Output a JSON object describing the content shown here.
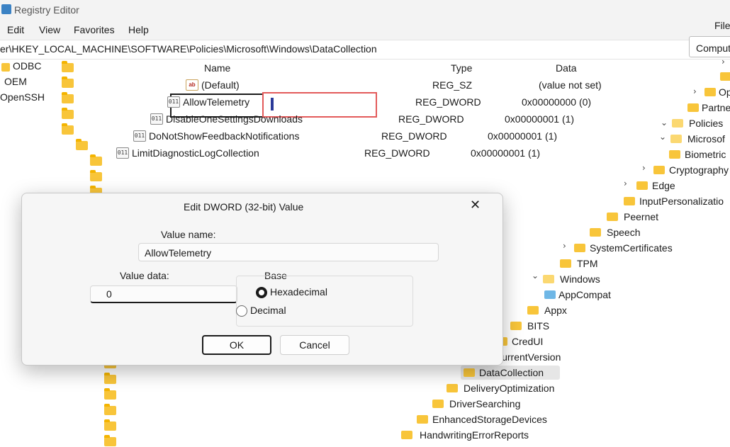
{
  "window": {
    "title": "Registry Editor",
    "right_menu": "File"
  },
  "menu": {
    "items": [
      "Edit",
      "View",
      "Favorites",
      "Help"
    ]
  },
  "address": {
    "path": "er\\HKEY_LOCAL_MACHINE\\SOFTWARE\\Policies\\Microsoft\\Windows\\DataCollection",
    "right_path": "Compute"
  },
  "left_tree": [
    "ODBC",
    "OEM",
    "OpenSSH"
  ],
  "list": {
    "headers": {
      "name": "Name",
      "type": "Type",
      "data": "Data"
    },
    "rows": [
      {
        "name": "(Default)",
        "type": "REG_SZ",
        "data": "(value not set)"
      },
      {
        "name": "AllowTelemetry",
        "type": "REG_DWORD",
        "data": "0x00000000 (0)"
      },
      {
        "name": "DisableOneSettingsDownloads",
        "type": "REG_DWORD",
        "data": "0x00000001 (1)"
      },
      {
        "name": "DoNotShowFeedbackNotifications",
        "type": "REG_DWORD",
        "data": "0x00000001 (1)"
      },
      {
        "name": "LimitDiagnosticLogCollection",
        "type": "REG_DWORD",
        "data": "0x00000001 (1)"
      }
    ]
  },
  "dialog": {
    "title": "Edit DWORD (32-bit) Value",
    "value_name_label": "Value name:",
    "value_name": "AllowTelemetry",
    "value_data_label": "Value data:",
    "value_data": "0",
    "base_label": "Base",
    "hex_label": "Hexadecimal",
    "dec_label": "Decimal",
    "base_selected": "Hexadecimal",
    "ok": "OK",
    "cancel": "Cancel"
  },
  "right_tree": [
    "Op",
    "Partne",
    "Policies",
    "Microsof",
    "Biometric",
    "Cryptography",
    "Edge",
    "InputPersonalizatio",
    "Peernet",
    "Speech",
    "SystemCertificates",
    "TPM",
    "Windows",
    "AppCompat",
    "Appx",
    "BITS",
    "CredUI",
    "CurrentVersion",
    "DataCollection",
    "DeliveryOptimization",
    "DriverSearching",
    "EnhancedStorageDevices",
    "HandwritingErrorReports"
  ]
}
